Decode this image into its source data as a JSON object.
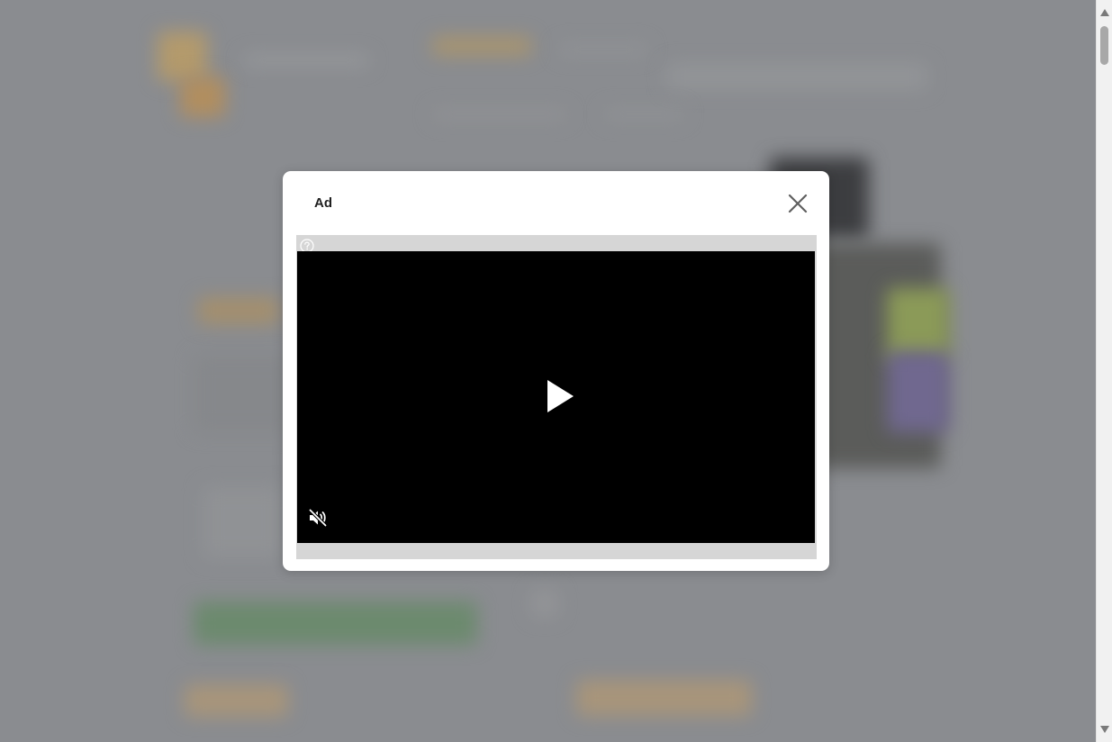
{
  "modal": {
    "title": "Ad",
    "close_icon": "close-icon"
  },
  "ad_player": {
    "help_icon": "help-icon",
    "play_icon": "play-icon",
    "mute_icon": "muted-speaker-icon",
    "video_state": "paused",
    "muted": true
  },
  "colors": {
    "overlay": "#8a8c90",
    "modal_background": "#ffffff",
    "video_background": "#000000",
    "ad_frame": "#d6d6d6"
  }
}
